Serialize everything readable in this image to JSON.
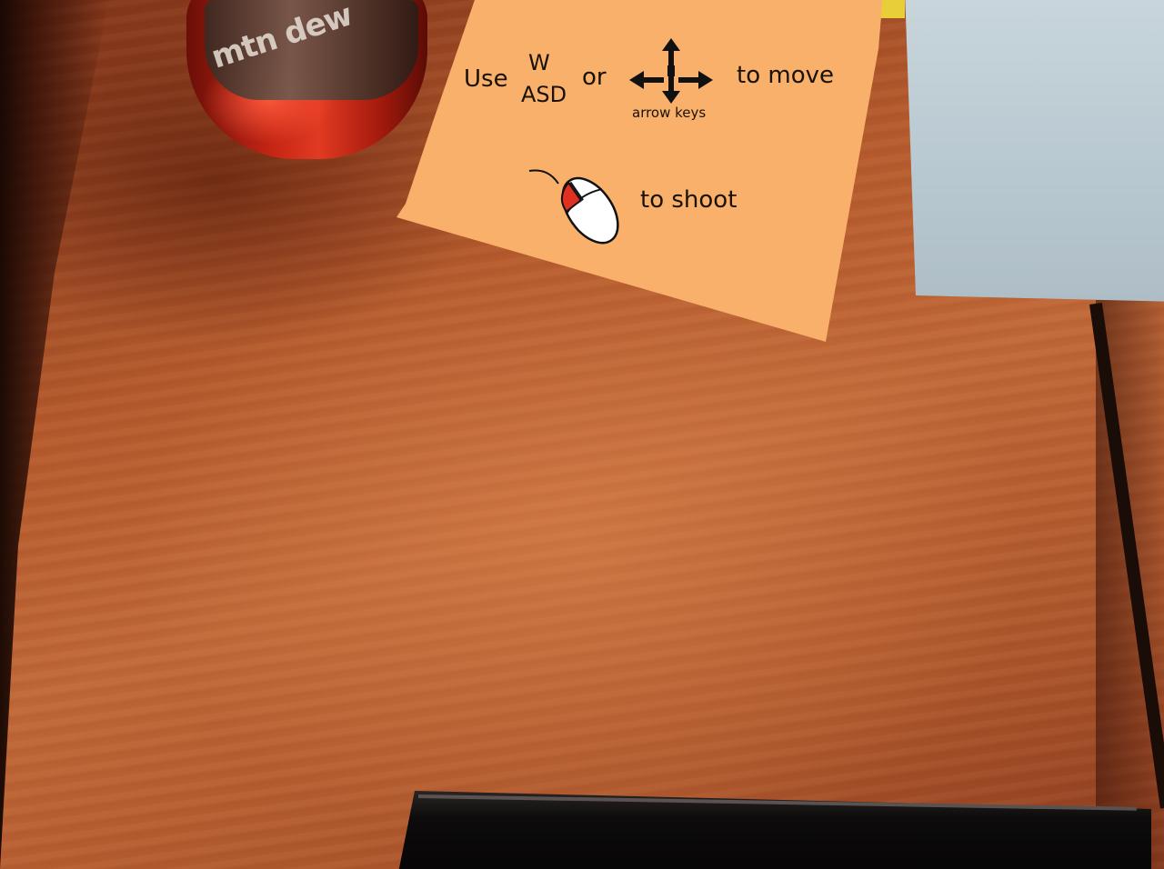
{
  "instructions": {
    "use_label": "Use",
    "keys_top": "W",
    "keys_bottom": "ASD",
    "or_label": "or",
    "arrow_keys_label": "arrow keys",
    "move_label": "to move",
    "shoot_label": "to shoot"
  },
  "scene": {
    "bottle_label": "mtn dew",
    "card_color": "#f8b06a",
    "mouse_button_color": "#e03020"
  },
  "icons": {
    "arrows": "arrow-keys-icon",
    "mouse": "mouse-icon"
  }
}
